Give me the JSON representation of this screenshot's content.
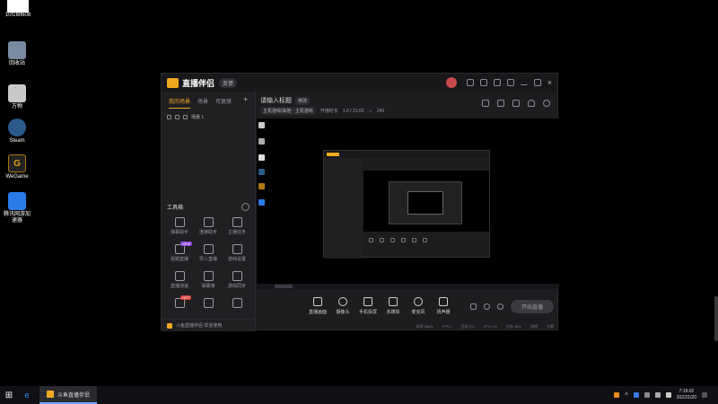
{
  "desktop": {
    "top_icon_label": "10f1f8f608",
    "icons": [
      {
        "name": "recycle-bin",
        "label": "回收站",
        "color": "#7a8aa0"
      },
      {
        "name": "computer",
        "label": "万物",
        "color": "#c8c8c8"
      },
      {
        "name": "steam",
        "label": "Steam",
        "color": "#2a5a8a"
      },
      {
        "name": "wegame",
        "label": "WeGame",
        "color": "#b07a10"
      },
      {
        "name": "game-booster",
        "label": "腾讯网游加速器",
        "color": "#2a7ae8"
      }
    ]
  },
  "app": {
    "title": "直播伴侣",
    "version_tag": "反馈",
    "left_tabs": [
      "我的场景",
      "场景",
      "可复原"
    ],
    "left_tab_add": "+",
    "scene_name": "场景 1",
    "tools_title": "工具箱",
    "tools": [
      {
        "label": "弹幕助手",
        "badge": ""
      },
      {
        "label": "连接助手",
        "badge": ""
      },
      {
        "label": "主播任务",
        "badge": ""
      },
      {
        "label": "视频直播",
        "badge": "NEW"
      },
      {
        "label": "导入直播",
        "badge": ""
      },
      {
        "label": "游戏设置",
        "badge": ""
      },
      {
        "label": "直播测速",
        "badge": ""
      },
      {
        "label": "弹幕墙",
        "badge": ""
      },
      {
        "label": "游戏同步",
        "badge": ""
      },
      {
        "label": "",
        "badge": "HOT"
      },
      {
        "label": "",
        "badge": ""
      },
      {
        "label": "",
        "badge": ""
      }
    ],
    "footer_text": "斗鱼直播伴侣 欢迎使用",
    "main_title": "请输入标题",
    "edit_tag": "修改",
    "category_chip": "主机游戏/其他 · 主机游戏",
    "sub_label": "开播时长",
    "time": "1.0 / 21:02",
    "viewers": "245",
    "controls": [
      "直播画面",
      "摄像头",
      "手机投屏",
      "多媒体",
      "麦克风",
      "扬声器"
    ],
    "start_button": "开始直播",
    "status_items": [
      "码率 0kb/s",
      "FPS 0",
      "丢帧 0%",
      "CPU 4%",
      "内存 48%",
      "网络",
      "字幕"
    ]
  },
  "taskbar": {
    "start_icon": "⊞",
    "app_label": "斗鱼直播伴侣",
    "clock_time": "7:19:02",
    "clock_date": "2022/1/20"
  }
}
